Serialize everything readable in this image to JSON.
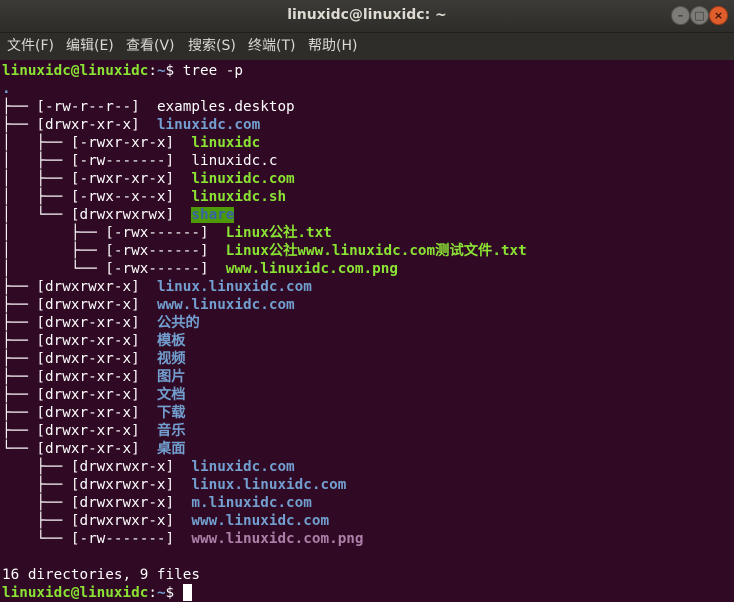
{
  "window": {
    "title": "linuxidc@linuxidc: ~"
  },
  "window_buttons": {
    "minimize": "–",
    "maximize": "□",
    "close": "×"
  },
  "menu": [
    "文件(F)",
    "编辑(E)",
    "查看(V)",
    "搜索(S)",
    "终端(T)",
    "帮助(H)"
  ],
  "prompt": {
    "user_host": "linuxidc@linuxidc",
    "sep": ":",
    "path": "~",
    "dollar": "$ ",
    "command": "tree -p"
  },
  "tree": {
    "root": ".",
    "lines": [
      {
        "prefix": "├── [-rw-r--r--]  ",
        "name": "examples.desktop",
        "style": "w"
      },
      {
        "prefix": "├── [drwxr-xr-x]  ",
        "name": "linuxidc.com",
        "style": "b"
      },
      {
        "prefix": "│   ├── [-rwxr-xr-x]  ",
        "name": "linuxidc",
        "style": "g"
      },
      {
        "prefix": "│   ├── [-rw-------]  ",
        "name": "linuxidc.c",
        "style": "w"
      },
      {
        "prefix": "│   ├── [-rwxr-xr-x]  ",
        "name": "linuxidc.com",
        "style": "g"
      },
      {
        "prefix": "│   ├── [-rwx--x--x]  ",
        "name": "linuxidc.sh",
        "style": "g"
      },
      {
        "prefix": "│   └── [drwxrwxrwx]  ",
        "name": "share",
        "style": "sh"
      },
      {
        "prefix": "│       ├── [-rwx------]  ",
        "name": "Linux公社.txt",
        "style": "g"
      },
      {
        "prefix": "│       ├── [-rwx------]  ",
        "name": "Linux公社www.linuxidc.com测试文件.txt",
        "style": "g"
      },
      {
        "prefix": "│       └── [-rwx------]  ",
        "name": "www.linuxidc.com.png",
        "style": "g"
      },
      {
        "prefix": "├── [drwxrwxr-x]  ",
        "name": "linux.linuxidc.com",
        "style": "b"
      },
      {
        "prefix": "├── [drwxrwxr-x]  ",
        "name": "www.linuxidc.com",
        "style": "b"
      },
      {
        "prefix": "├── [drwxr-xr-x]  ",
        "name": "公共的",
        "style": "b"
      },
      {
        "prefix": "├── [drwxr-xr-x]  ",
        "name": "模板",
        "style": "b"
      },
      {
        "prefix": "├── [drwxr-xr-x]  ",
        "name": "视频",
        "style": "b"
      },
      {
        "prefix": "├── [drwxr-xr-x]  ",
        "name": "图片",
        "style": "b"
      },
      {
        "prefix": "├── [drwxr-xr-x]  ",
        "name": "文档",
        "style": "b"
      },
      {
        "prefix": "├── [drwxr-xr-x]  ",
        "name": "下载",
        "style": "b"
      },
      {
        "prefix": "├── [drwxr-xr-x]  ",
        "name": "音乐",
        "style": "b"
      },
      {
        "prefix": "└── [drwxr-xr-x]  ",
        "name": "桌面",
        "style": "b"
      },
      {
        "prefix": "    ├── [drwxrwxr-x]  ",
        "name": "linuxidc.com",
        "style": "b"
      },
      {
        "prefix": "    ├── [drwxrwxr-x]  ",
        "name": "linux.linuxidc.com",
        "style": "b"
      },
      {
        "prefix": "    ├── [drwxrwxr-x]  ",
        "name": "m.linuxidc.com",
        "style": "b"
      },
      {
        "prefix": "    ├── [drwxrwxr-x]  ",
        "name": "www.linuxidc.com",
        "style": "b"
      },
      {
        "prefix": "    └── [-rw-------]  ",
        "name": "www.linuxidc.com.png",
        "style": "pk"
      }
    ]
  },
  "summary": "16 directories, 9 files",
  "colors": {
    "background": "#300a24",
    "prompt_green": "#8ae234",
    "dir_blue": "#729fcf",
    "image_pink": "#ad7fa8",
    "share_bg": "#4e9a06",
    "titlebar": "#3c3b37",
    "close_button": "#e05d2c"
  }
}
